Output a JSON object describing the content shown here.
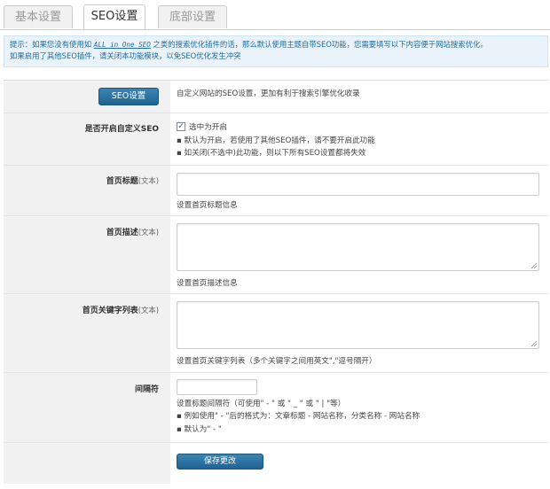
{
  "tabs": [
    {
      "label": "基本设置"
    },
    {
      "label": "SEO设置"
    },
    {
      "label": "底部设置"
    }
  ],
  "notice": {
    "line1_prefix": "提示：如果您没有使用如",
    "line1_plugin": "ALL in One SEO",
    "line1_suffix": "之类的搜索优化插件的话，那么默认使用主题自带SEO功能，您需要填写以下内容便于网站搜索优化。",
    "line2": "如果启用了其他SEO插件，请关闭本功能模块，以免SEO优化发生冲突"
  },
  "header": {
    "button_label": "SEO设置",
    "description": "自定义网站的SEO设置，更加有利于搜索引擎优化收录"
  },
  "enable": {
    "label": "是否开启自定义SEO",
    "checkbox_mark": "✓",
    "checkbox_text": "选中为开启",
    "note1": "▪ 默认为开启，若使用了其他SEO插件，请不要开启此功能",
    "note2": "▪ 如关闭(不选中)此功能，则以下所有SEO设置都将失效"
  },
  "home_title": {
    "label": "首页标题",
    "type": "(文本)",
    "value": "",
    "hint": "设置首页标题信息"
  },
  "home_desc": {
    "label": "首页描述",
    "type": "(文本)",
    "value": "",
    "hint": "设置首页描述信息"
  },
  "home_keywords": {
    "label": "首页关键字列表",
    "type": "(文本)",
    "value": "",
    "hint": "设置首页关键字列表（多个关键字之间用英文\",\"逗号隔开）"
  },
  "separator": {
    "label": "间隔符",
    "value": "",
    "hint": "设置标题间隔符（可使用\" - \" 或 \" _ \" 或 \" | \"等）",
    "note1": "▪ 例如使用\" - \"后的格式为：文章标题 - 网站名称，分类名称 - 网站名称",
    "note2": "▪ 默认为\" - \""
  },
  "save": {
    "label": "保存更改"
  }
}
